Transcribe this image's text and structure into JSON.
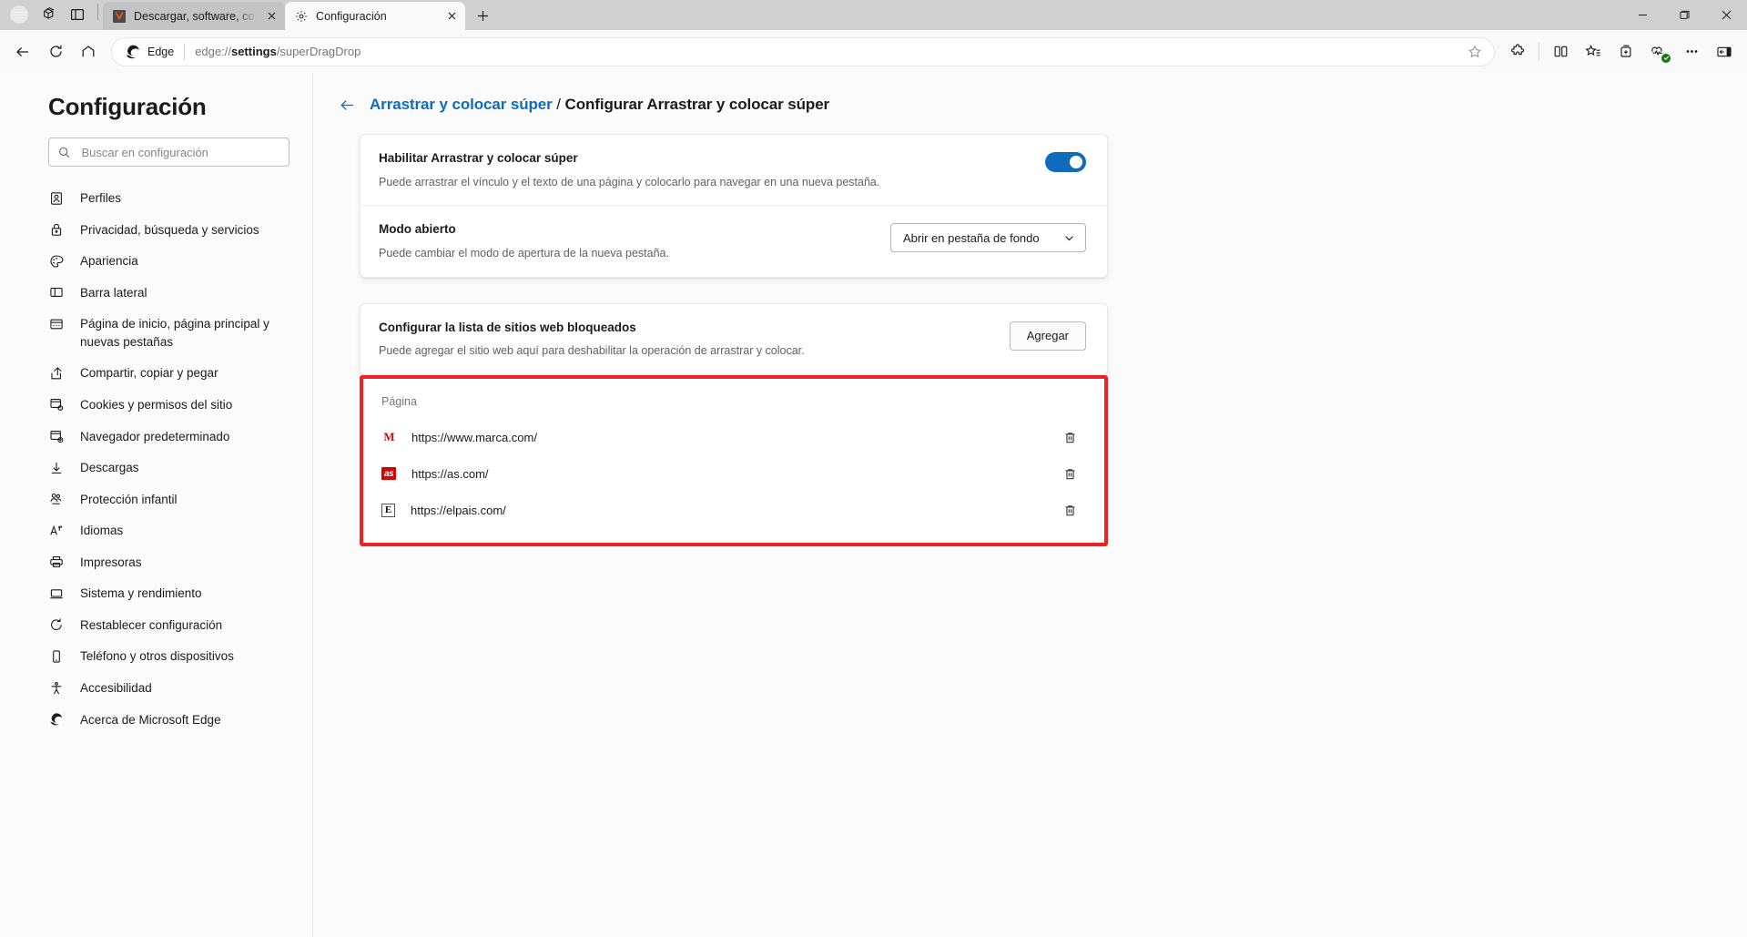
{
  "window": {
    "controls": [
      {
        "name": "minimize-button",
        "glyph": "minimize"
      },
      {
        "name": "maximize-button",
        "glyph": "maximize"
      },
      {
        "name": "close-button",
        "glyph": "close"
      }
    ]
  },
  "tabstrip": {
    "profile_icon": "avatar-icon",
    "workspaces_icon": "workspaces-icon",
    "tab_actions_icon": "tab-actions-icon",
    "new_tab_label": "+",
    "tabs": [
      {
        "title": "Descargar, software, controladores",
        "favicon": "vivaldi-favicon",
        "active": false,
        "close_label": "×"
      },
      {
        "title": "Configuración",
        "favicon": "gear-icon",
        "active": true,
        "close_label": "×"
      }
    ]
  },
  "toolbar": {
    "back_label": "Atrás",
    "refresh_label": "Actualizar",
    "home_label": "Inicio",
    "edge_badge_label": "Edge",
    "url_prefix": "edge://",
    "url_bold": "settings",
    "url_suffix": "/superDragDrop",
    "url_full": "edge://settings/superDragDrop",
    "favorite_icon": "star-icon",
    "extensions_icon": "puzzle-icon",
    "split_screen_icon": "split-screen-icon",
    "favorites_bar_icon": "favorites-star-list-icon",
    "collections_icon": "collections-icon",
    "browser_essentials_icon": "browser-essentials-icon",
    "settings_more_icon": "ellipsis-icon",
    "sidebar_icon": "sidebar-toggle-icon"
  },
  "sidebar": {
    "title": "Configuración",
    "search": {
      "placeholder": "Buscar en configuración",
      "value": "",
      "icon": "search-icon"
    },
    "items": [
      {
        "label": "Perfiles",
        "icon": "profile-icon"
      },
      {
        "label": "Privacidad, búsqueda y servicios",
        "icon": "lock-icon"
      },
      {
        "label": "Apariencia",
        "icon": "palette-icon"
      },
      {
        "label": "Barra lateral",
        "icon": "sidebar-icon"
      },
      {
        "label": "Página de inicio, página principal y nuevas pestañas",
        "icon": "start-page-icon"
      },
      {
        "label": "Compartir, copiar y pegar",
        "icon": "share-icon"
      },
      {
        "label": "Cookies y permisos del sitio",
        "icon": "cookies-icon"
      },
      {
        "label": "Navegador predeterminado",
        "icon": "default-browser-icon"
      },
      {
        "label": "Descargas",
        "icon": "download-icon"
      },
      {
        "label": "Protección infantil",
        "icon": "family-safety-icon"
      },
      {
        "label": "Idiomas",
        "icon": "languages-icon"
      },
      {
        "label": "Impresoras",
        "icon": "printer-icon"
      },
      {
        "label": "Sistema y rendimiento",
        "icon": "system-icon"
      },
      {
        "label": "Restablecer configuración",
        "icon": "reset-icon"
      },
      {
        "label": "Teléfono y otros dispositivos",
        "icon": "phone-icon"
      },
      {
        "label": "Accesibilidad",
        "icon": "accessibility-icon"
      },
      {
        "label": "Acerca de Microsoft Edge",
        "icon": "edge-logo-icon"
      }
    ]
  },
  "main": {
    "breadcrumb": {
      "back_icon": "back-arrow-icon",
      "parent": "Arrastrar y colocar súper",
      "separator": " / ",
      "current": "Configurar Arrastrar y colocar súper"
    },
    "settings_card": {
      "enable_row": {
        "title": "Habilitar Arrastrar y colocar súper",
        "description": "Puede arrastrar el vínculo y el texto de una página y colocarlo para navegar en una nueva pestaña.",
        "toggle_on": true
      },
      "mode_row": {
        "title": "Modo abierto",
        "description": "Puede cambiar el modo de apertura de la nueva pestaña.",
        "selected_option": "Abrir en pestaña de fondo",
        "chevron_icon": "chevron-down-icon"
      }
    },
    "blocklist_card": {
      "title": "Configurar la lista de sitios web bloqueados",
      "description": "Puede agregar el sitio web aquí para deshabilitar la operación de arrastrar y colocar.",
      "add_button": "Agregar"
    },
    "blocklist_table": {
      "highlight_color": "#ee2222",
      "column_header": "Página",
      "delete_icon": "trash-icon",
      "rows": [
        {
          "url": "https://www.marca.com/",
          "favicon": "marca-favicon",
          "favicon_letter": "M"
        },
        {
          "url": "https://as.com/",
          "favicon": "as-favicon",
          "favicon_letter": "as"
        },
        {
          "url": "https://elpais.com/",
          "favicon": "elpais-favicon",
          "favicon_letter": "E"
        }
      ]
    }
  },
  "colors": {
    "accent": "#0f6cbd",
    "highlight": "#ee2222",
    "titlebar_bg": "#d0d0d0",
    "toolbar_bg": "#f9f9f9"
  }
}
